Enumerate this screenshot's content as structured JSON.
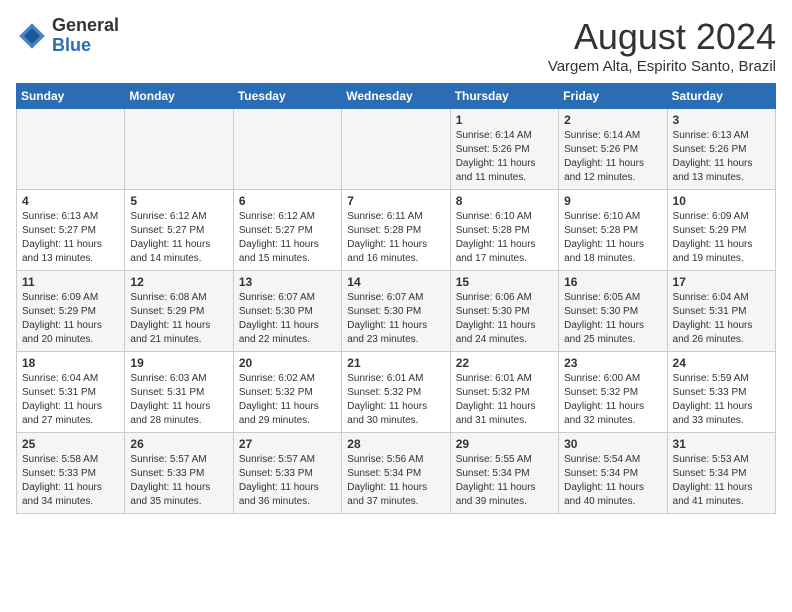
{
  "header": {
    "logo_general": "General",
    "logo_blue": "Blue",
    "month_title": "August 2024",
    "location": "Vargem Alta, Espirito Santo, Brazil"
  },
  "calendar": {
    "weekdays": [
      "Sunday",
      "Monday",
      "Tuesday",
      "Wednesday",
      "Thursday",
      "Friday",
      "Saturday"
    ],
    "weeks": [
      [
        {
          "day": "",
          "info": ""
        },
        {
          "day": "",
          "info": ""
        },
        {
          "day": "",
          "info": ""
        },
        {
          "day": "",
          "info": ""
        },
        {
          "day": "1",
          "info": "Sunrise: 6:14 AM\nSunset: 5:26 PM\nDaylight: 11 hours and 11 minutes."
        },
        {
          "day": "2",
          "info": "Sunrise: 6:14 AM\nSunset: 5:26 PM\nDaylight: 11 hours and 12 minutes."
        },
        {
          "day": "3",
          "info": "Sunrise: 6:13 AM\nSunset: 5:26 PM\nDaylight: 11 hours and 13 minutes."
        }
      ],
      [
        {
          "day": "4",
          "info": "Sunrise: 6:13 AM\nSunset: 5:27 PM\nDaylight: 11 hours and 13 minutes."
        },
        {
          "day": "5",
          "info": "Sunrise: 6:12 AM\nSunset: 5:27 PM\nDaylight: 11 hours and 14 minutes."
        },
        {
          "day": "6",
          "info": "Sunrise: 6:12 AM\nSunset: 5:27 PM\nDaylight: 11 hours and 15 minutes."
        },
        {
          "day": "7",
          "info": "Sunrise: 6:11 AM\nSunset: 5:28 PM\nDaylight: 11 hours and 16 minutes."
        },
        {
          "day": "8",
          "info": "Sunrise: 6:10 AM\nSunset: 5:28 PM\nDaylight: 11 hours and 17 minutes."
        },
        {
          "day": "9",
          "info": "Sunrise: 6:10 AM\nSunset: 5:28 PM\nDaylight: 11 hours and 18 minutes."
        },
        {
          "day": "10",
          "info": "Sunrise: 6:09 AM\nSunset: 5:29 PM\nDaylight: 11 hours and 19 minutes."
        }
      ],
      [
        {
          "day": "11",
          "info": "Sunrise: 6:09 AM\nSunset: 5:29 PM\nDaylight: 11 hours and 20 minutes."
        },
        {
          "day": "12",
          "info": "Sunrise: 6:08 AM\nSunset: 5:29 PM\nDaylight: 11 hours and 21 minutes."
        },
        {
          "day": "13",
          "info": "Sunrise: 6:07 AM\nSunset: 5:30 PM\nDaylight: 11 hours and 22 minutes."
        },
        {
          "day": "14",
          "info": "Sunrise: 6:07 AM\nSunset: 5:30 PM\nDaylight: 11 hours and 23 minutes."
        },
        {
          "day": "15",
          "info": "Sunrise: 6:06 AM\nSunset: 5:30 PM\nDaylight: 11 hours and 24 minutes."
        },
        {
          "day": "16",
          "info": "Sunrise: 6:05 AM\nSunset: 5:30 PM\nDaylight: 11 hours and 25 minutes."
        },
        {
          "day": "17",
          "info": "Sunrise: 6:04 AM\nSunset: 5:31 PM\nDaylight: 11 hours and 26 minutes."
        }
      ],
      [
        {
          "day": "18",
          "info": "Sunrise: 6:04 AM\nSunset: 5:31 PM\nDaylight: 11 hours and 27 minutes."
        },
        {
          "day": "19",
          "info": "Sunrise: 6:03 AM\nSunset: 5:31 PM\nDaylight: 11 hours and 28 minutes."
        },
        {
          "day": "20",
          "info": "Sunrise: 6:02 AM\nSunset: 5:32 PM\nDaylight: 11 hours and 29 minutes."
        },
        {
          "day": "21",
          "info": "Sunrise: 6:01 AM\nSunset: 5:32 PM\nDaylight: 11 hours and 30 minutes."
        },
        {
          "day": "22",
          "info": "Sunrise: 6:01 AM\nSunset: 5:32 PM\nDaylight: 11 hours and 31 minutes."
        },
        {
          "day": "23",
          "info": "Sunrise: 6:00 AM\nSunset: 5:32 PM\nDaylight: 11 hours and 32 minutes."
        },
        {
          "day": "24",
          "info": "Sunrise: 5:59 AM\nSunset: 5:33 PM\nDaylight: 11 hours and 33 minutes."
        }
      ],
      [
        {
          "day": "25",
          "info": "Sunrise: 5:58 AM\nSunset: 5:33 PM\nDaylight: 11 hours and 34 minutes."
        },
        {
          "day": "26",
          "info": "Sunrise: 5:57 AM\nSunset: 5:33 PM\nDaylight: 11 hours and 35 minutes."
        },
        {
          "day": "27",
          "info": "Sunrise: 5:57 AM\nSunset: 5:33 PM\nDaylight: 11 hours and 36 minutes."
        },
        {
          "day": "28",
          "info": "Sunrise: 5:56 AM\nSunset: 5:34 PM\nDaylight: 11 hours and 37 minutes."
        },
        {
          "day": "29",
          "info": "Sunrise: 5:55 AM\nSunset: 5:34 PM\nDaylight: 11 hours and 39 minutes."
        },
        {
          "day": "30",
          "info": "Sunrise: 5:54 AM\nSunset: 5:34 PM\nDaylight: 11 hours and 40 minutes."
        },
        {
          "day": "31",
          "info": "Sunrise: 5:53 AM\nSunset: 5:34 PM\nDaylight: 11 hours and 41 minutes."
        }
      ]
    ]
  }
}
